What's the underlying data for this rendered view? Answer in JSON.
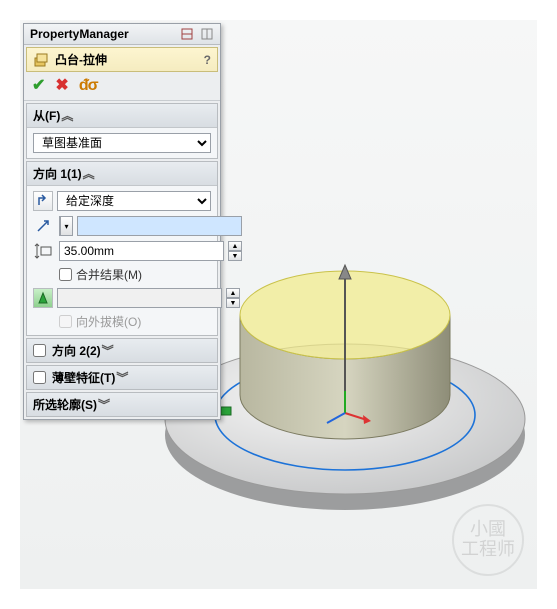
{
  "header": {
    "title": "PropertyManager"
  },
  "feature": {
    "title": "凸台-拉伸"
  },
  "from": {
    "label": "从(F)",
    "selected": "草图基准面"
  },
  "direction1": {
    "label": "方向 1(1)",
    "end_condition": "给定深度",
    "depth_value": "35.00mm",
    "swatch_color": "#e0e0e0",
    "merge_label": "合并结果(M)",
    "merge_checked": false,
    "draft_color": "#2aa33a",
    "draft_outward_label": "向外拔模(O)"
  },
  "direction2": {
    "label": "方向 2(2)"
  },
  "thin": {
    "label": "薄壁特征(T)"
  },
  "contours": {
    "label": "所选轮廓(S)"
  },
  "watermark": {
    "line1": "小國",
    "line2": "工程师"
  }
}
